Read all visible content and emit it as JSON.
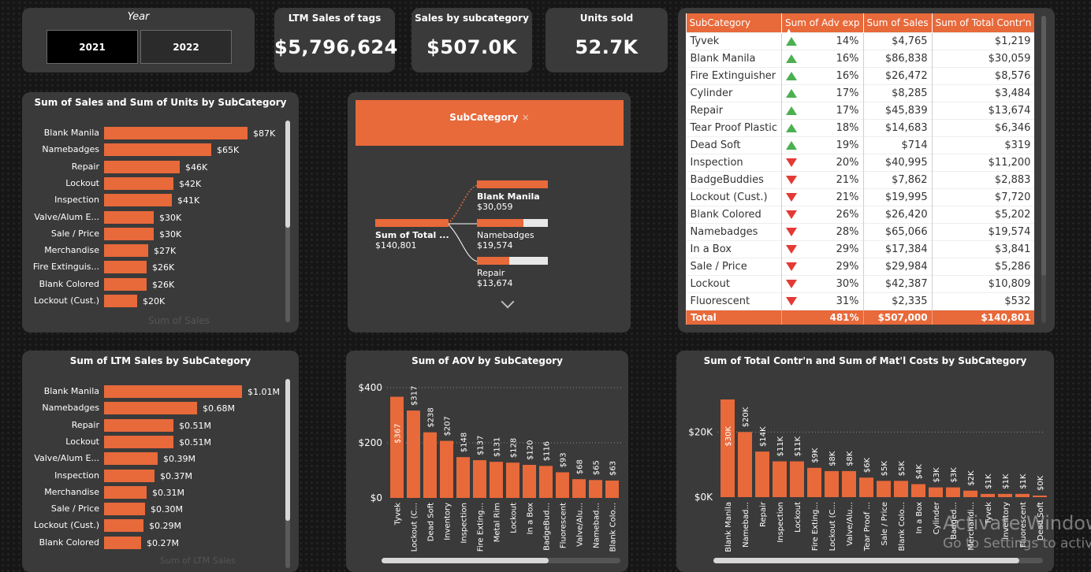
{
  "slicer": {
    "title": "Year",
    "options": [
      "2021",
      "2022"
    ],
    "selected": "2021"
  },
  "kpis": [
    {
      "title": "LTM Sales of tags",
      "value": "$5,796,624"
    },
    {
      "title": "Sales by subcategory",
      "value": "$507.0K"
    },
    {
      "title": "Units sold",
      "value": "52.7K"
    }
  ],
  "table": {
    "columns": [
      "SubCategory",
      "Sum of Adv exp",
      "Sum of Sales",
      "Sum of Total Contr'n"
    ],
    "rows": [
      {
        "name": "Tyvek",
        "trend": "up",
        "adv": "14%",
        "sales": "$4,765",
        "contr": "$1,219"
      },
      {
        "name": "Blank Manila",
        "trend": "up",
        "adv": "16%",
        "sales": "$86,838",
        "contr": "$30,059"
      },
      {
        "name": "Fire Extinguisher",
        "trend": "up",
        "adv": "16%",
        "sales": "$26,472",
        "contr": "$8,576"
      },
      {
        "name": "Cylinder",
        "trend": "up",
        "adv": "17%",
        "sales": "$8,285",
        "contr": "$3,484"
      },
      {
        "name": "Repair",
        "trend": "up",
        "adv": "17%",
        "sales": "$45,839",
        "contr": "$13,674"
      },
      {
        "name": "Tear Proof Plastic",
        "trend": "up",
        "adv": "18%",
        "sales": "$14,683",
        "contr": "$6,346"
      },
      {
        "name": "Dead Soft",
        "trend": "up",
        "adv": "19%",
        "sales": "$714",
        "contr": "$319"
      },
      {
        "name": "Inspection",
        "trend": "down",
        "adv": "20%",
        "sales": "$40,995",
        "contr": "$11,200"
      },
      {
        "name": "BadgeBuddies",
        "trend": "down",
        "adv": "21%",
        "sales": "$7,862",
        "contr": "$2,883"
      },
      {
        "name": "Lockout (Cust.)",
        "trend": "down",
        "adv": "21%",
        "sales": "$19,995",
        "contr": "$7,720"
      },
      {
        "name": "Blank Colored",
        "trend": "down",
        "adv": "26%",
        "sales": "$26,420",
        "contr": "$5,202"
      },
      {
        "name": "Namebadges",
        "trend": "down",
        "adv": "28%",
        "sales": "$65,066",
        "contr": "$19,574"
      },
      {
        "name": "In a Box",
        "trend": "down",
        "adv": "29%",
        "sales": "$17,384",
        "contr": "$3,841"
      },
      {
        "name": "Sale / Price",
        "trend": "down",
        "adv": "29%",
        "sales": "$29,984",
        "contr": "$5,286"
      },
      {
        "name": "Lockout",
        "trend": "down",
        "adv": "30%",
        "sales": "$42,387",
        "contr": "$10,809"
      },
      {
        "name": "Fluorescent",
        "trend": "down",
        "adv": "31%",
        "sales": "$2,335",
        "contr": "$532"
      }
    ],
    "total": {
      "name": "Total",
      "adv": "481%",
      "sales": "$507,000",
      "contr": "$140,801"
    }
  },
  "decomp": {
    "header": "SubCategory",
    "close_glyph": "×",
    "root": {
      "label": "Sum of Total ...",
      "value": "$140,801"
    },
    "children": [
      {
        "label": "Blank Manila",
        "value": "$30,059",
        "fill": 1.0,
        "bold": true
      },
      {
        "label": "Namebadges",
        "value": "$19,574",
        "fill": 0.65,
        "bold": false
      },
      {
        "label": "Repair",
        "value": "$13,674",
        "fill": 0.455,
        "bold": false
      }
    ],
    "expand_glyph": "⌄"
  },
  "colors": {
    "accent": "#e8693a",
    "up": "#4caf50",
    "down": "#e53935"
  },
  "chart_data": [
    {
      "type": "bar",
      "orientation": "horizontal",
      "title": "Sum of Sales and Sum of Units by SubCategory",
      "xlabel": "Sum of Sales",
      "categories": [
        "Blank Manila",
        "Namebadges",
        "Repair",
        "Lockout",
        "Inspection",
        "Valve/Alum E...",
        "Sale / Price",
        "Merchandise",
        "Fire Extinguis...",
        "Blank Colored",
        "Lockout (Cust.)"
      ],
      "values": [
        87,
        65,
        46,
        42,
        41,
        30,
        30,
        27,
        26,
        26,
        20
      ],
      "labels": [
        "$87K",
        "$65K",
        "$46K",
        "$42K",
        "$41K",
        "$30K",
        "$30K",
        "$27K",
        "$26K",
        "$26K",
        "$20K"
      ]
    },
    {
      "type": "bar",
      "orientation": "horizontal",
      "title": "Sum of LTM Sales by SubCategory",
      "xlabel": "Sum of LTM Sales",
      "categories": [
        "Blank Manila",
        "Namebadges",
        "Repair",
        "Lockout",
        "Valve/Alum E...",
        "Inspection",
        "Merchandise",
        "Sale / Price",
        "Lockout (Cust.)",
        "Blank Colored"
      ],
      "values": [
        1.01,
        0.68,
        0.51,
        0.51,
        0.39,
        0.37,
        0.31,
        0.3,
        0.29,
        0.27
      ],
      "labels": [
        "$1.01M",
        "$0.68M",
        "$0.51M",
        "$0.51M",
        "$0.39M",
        "$0.37M",
        "$0.31M",
        "$0.30M",
        "$0.29M",
        "$0.27M"
      ]
    },
    {
      "type": "bar",
      "title": "Sum of AOV by SubCategory",
      "categories": [
        "Tyvek",
        "Lockout (C...",
        "Dead Soft",
        "Inventory",
        "Inspection",
        "Fire Exting...",
        "Metal Rim",
        "Lockout",
        "In a Box",
        "BadgeBud...",
        "Fluorescent",
        "Valve/Alu...",
        "Namebad...",
        "Blank Colo..."
      ],
      "values": [
        367,
        317,
        238,
        207,
        148,
        137,
        131,
        128,
        120,
        116,
        93,
        68,
        65,
        63
      ],
      "labels": [
        "$367",
        "$317",
        "$238",
        "$207",
        "$148",
        "$137",
        "$131",
        "$128",
        "$120",
        "$116",
        "$93",
        "$68",
        "$65",
        "$63"
      ],
      "yticks": [
        "$0",
        "$200",
        "$400"
      ],
      "ylim": [
        0,
        400
      ]
    },
    {
      "type": "bar",
      "title": "Sum of Total Contr'n and Sum of Mat'l Costs by SubCategory",
      "categories": [
        "Blank Manila",
        "Namebad...",
        "Repair",
        "Inspection",
        "Lockout",
        "Fire Exting...",
        "Lockout (C...",
        "Valve/Alu...",
        "Tear Proof ...",
        "Sale / Price",
        "Blank Colo...",
        "In a Box",
        "Cylinder",
        "Badged...",
        "Merchandi...",
        "Tyvek",
        "Inventory",
        "Fluorescent",
        "Dead Soft"
      ],
      "values": [
        30,
        20,
        14,
        11,
        11,
        9,
        8,
        8,
        6,
        5,
        5,
        4,
        3,
        3,
        2,
        1,
        1,
        1,
        0
      ],
      "labels": [
        "$30K",
        "$20K",
        "$14K",
        "$11K",
        "$11K",
        "$9K",
        "$8K",
        "$8K",
        "$6K",
        "$5K",
        "$5K",
        "$4K",
        "$3K",
        "$3K",
        "$2K",
        "$1K",
        "$1K",
        "$1K",
        "$0K"
      ],
      "yticks": [
        "$0K",
        "$20K"
      ],
      "ylim": [
        0,
        30
      ]
    }
  ],
  "watermark": {
    "line1": "Activate Windows",
    "line2": "Go to Settings to activate Windows."
  }
}
